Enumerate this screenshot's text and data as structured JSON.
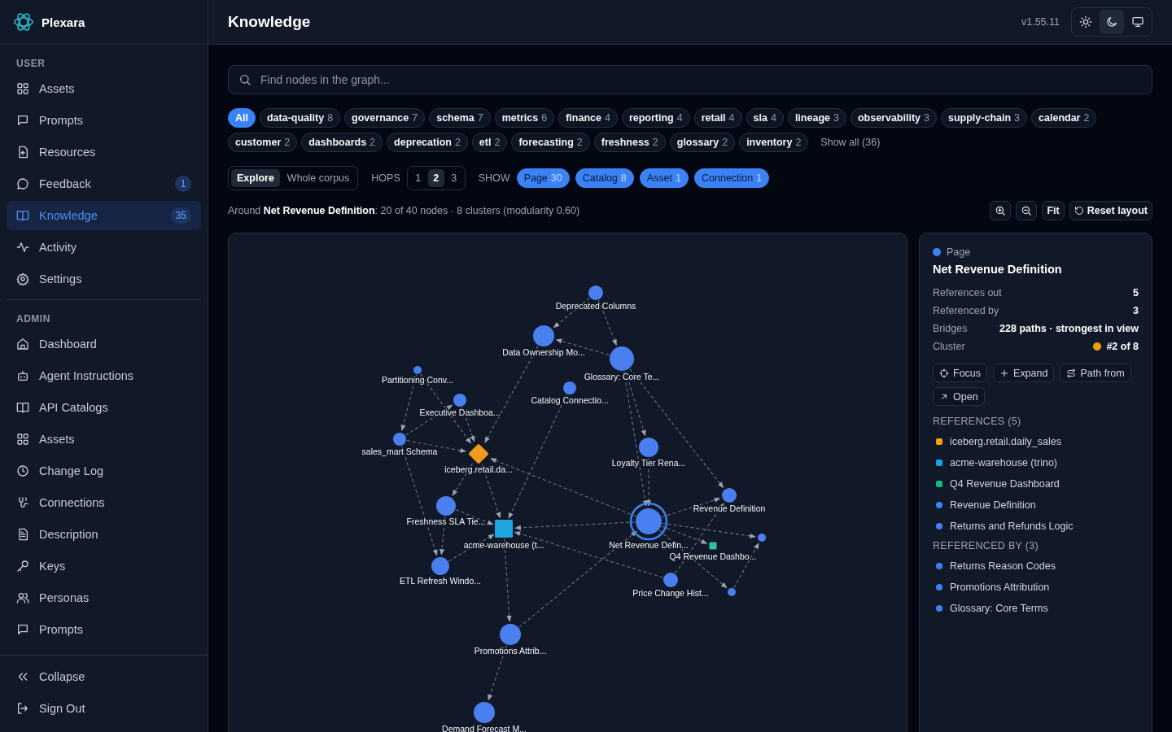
{
  "brand": {
    "name": "Plexara"
  },
  "sidebar": {
    "sections": [
      {
        "title": "USER",
        "items": [
          {
            "label": "Assets",
            "selected": false
          },
          {
            "label": "Prompts",
            "selected": false
          },
          {
            "label": "Resources",
            "selected": false
          },
          {
            "label": "Feedback",
            "badge": "1",
            "selected": false
          },
          {
            "label": "Knowledge",
            "badge": "35",
            "selected": true
          },
          {
            "label": "Activity",
            "selected": false
          },
          {
            "label": "Settings",
            "selected": false
          }
        ]
      },
      {
        "title": "ADMIN",
        "items": [
          {
            "label": "Dashboard",
            "selected": false
          },
          {
            "label": "Agent Instructions",
            "selected": false
          },
          {
            "label": "API Catalogs",
            "selected": false
          },
          {
            "label": "Assets",
            "selected": false
          },
          {
            "label": "Change Log",
            "selected": false
          },
          {
            "label": "Connections",
            "selected": false
          },
          {
            "label": "Description",
            "selected": false
          },
          {
            "label": "Keys",
            "selected": false
          },
          {
            "label": "Personas",
            "selected": false
          },
          {
            "label": "Prompts",
            "selected": false
          }
        ]
      }
    ],
    "footer": [
      {
        "label": "Collapse"
      },
      {
        "label": "Sign Out"
      }
    ]
  },
  "header": {
    "title": "Knowledge",
    "version": "v1.55.11",
    "theme_buttons": [
      {
        "selected": false
      },
      {
        "selected": true
      },
      {
        "selected": false
      }
    ]
  },
  "search": {
    "placeholder": "Find nodes in the graph..."
  },
  "tags": [
    {
      "label": "All",
      "selected": true
    },
    {
      "label": "data-quality",
      "count": "8",
      "selected": false
    },
    {
      "label": "governance",
      "count": "7",
      "selected": false
    },
    {
      "label": "schema",
      "count": "7",
      "selected": false
    },
    {
      "label": "metrics",
      "count": "6",
      "selected": false
    },
    {
      "label": "finance",
      "count": "4",
      "selected": false
    },
    {
      "label": "reporting",
      "count": "4",
      "selected": false
    },
    {
      "label": "retail",
      "count": "4",
      "selected": false
    },
    {
      "label": "sla",
      "count": "4",
      "selected": false
    },
    {
      "label": "lineage",
      "count": "3",
      "selected": false
    },
    {
      "label": "observability",
      "count": "3",
      "selected": false
    },
    {
      "label": "supply-chain",
      "count": "3",
      "selected": false
    },
    {
      "label": "calendar",
      "count": "2",
      "selected": false
    },
    {
      "label": "customer",
      "count": "2",
      "selected": false
    },
    {
      "label": "dashboards",
      "count": "2",
      "selected": false
    },
    {
      "label": "deprecation",
      "count": "2",
      "selected": false
    },
    {
      "label": "etl",
      "count": "2",
      "selected": false
    },
    {
      "label": "forecasting",
      "count": "2",
      "selected": false
    },
    {
      "label": "freshness",
      "count": "2",
      "selected": false
    },
    {
      "label": "glossary",
      "count": "2",
      "selected": false
    },
    {
      "label": "inventory",
      "count": "2",
      "selected": false
    }
  ],
  "show_all": "Show all (36)",
  "mode_tabs": [
    {
      "label": "Explore",
      "selected": true
    },
    {
      "label": "Whole corpus",
      "selected": false
    }
  ],
  "hops": {
    "label": "HOPS",
    "options": [
      {
        "label": "1",
        "selected": false
      },
      {
        "label": "2",
        "selected": true
      },
      {
        "label": "3",
        "selected": false
      }
    ]
  },
  "show": {
    "label": "SHOW",
    "filters": [
      {
        "label": "Page",
        "count": "30",
        "on": true
      },
      {
        "label": "Catalog",
        "count": "8",
        "on": true
      },
      {
        "label": "Asset",
        "count": "1",
        "on": true
      },
      {
        "label": "Connection",
        "count": "1",
        "on": true
      }
    ]
  },
  "summary": "Around **Net Revenue Definition**: 20 of 40 nodes · 8 clusters (modularity 0.60)",
  "graph_toolbar": {
    "fit": "Fit",
    "reset": "Reset layout"
  },
  "graph": {
    "nodes": [
      {
        "label": "Deprecated Columns",
        "kind": "page",
        "selected": false
      },
      {
        "label": "Data Ownership Mo...",
        "kind": "page",
        "selected": false
      },
      {
        "label": "Glossary: Core Te...",
        "kind": "page",
        "selected": false
      },
      {
        "label": "Partitioning Conv...",
        "kind": "page",
        "selected": false
      },
      {
        "label": "Catalog Connectio...",
        "kind": "page",
        "selected": false
      },
      {
        "label": "Executive Dashboa...",
        "kind": "page",
        "selected": false
      },
      {
        "label": "sales_mart Schema",
        "kind": "page",
        "selected": false
      },
      {
        "label": "iceberg.retail.da...",
        "kind": "asset",
        "selected": false
      },
      {
        "label": "Loyalty Tier Rena...",
        "kind": "page",
        "selected": false
      },
      {
        "label": "Revenue Definition",
        "kind": "page",
        "selected": false
      },
      {
        "label": "Freshness SLA Tie...",
        "kind": "page",
        "selected": false
      },
      {
        "label": "acme-warehouse (t...",
        "kind": "connection",
        "selected": false
      },
      {
        "label": "Net Revenue Defin...",
        "kind": "page",
        "selected": true
      },
      {
        "kind": "page",
        "selected": false
      },
      {
        "label": "Q4 Revenue Dashbo...",
        "kind": "catalog",
        "selected": false
      },
      {
        "label": "ETL Refresh Windo...",
        "kind": "page",
        "selected": false
      },
      {
        "label": "Price Change Hist...",
        "kind": "page",
        "selected": false
      },
      {
        "kind": "page",
        "selected": false
      },
      {
        "label": "Promotions Attrib...",
        "kind": "page",
        "selected": false
      },
      {
        "label": "Demand Forecast M...",
        "kind": "page",
        "selected": false
      }
    ],
    "selected_node_ring": true
  },
  "details": {
    "type": {
      "label": "Page",
      "color": "#3b82f6"
    },
    "title": "Net Revenue Definition",
    "stats": [
      {
        "label": "References out",
        "value": "5"
      },
      {
        "label": "Referenced by",
        "value": "3"
      },
      {
        "label": "Bridges",
        "value": "228 paths · strongest in view"
      },
      {
        "label": "Cluster",
        "value": "#2 of 8",
        "color": "#f59e0b"
      }
    ],
    "actions": [
      {
        "label": "Focus"
      },
      {
        "label": "Expand"
      },
      {
        "label": "Path from"
      },
      {
        "label": "Open"
      }
    ],
    "references": {
      "title": "REFERENCES (5)",
      "items": [
        {
          "label": "iceberg.retail.daily_sales",
          "kind": "asset",
          "color": "#f59e0b"
        },
        {
          "label": "acme-warehouse (trino)",
          "kind": "connection",
          "color": "#0ea5e9"
        },
        {
          "label": "Q4 Revenue Dashboard",
          "kind": "catalog",
          "color": "#10b981"
        },
        {
          "label": "Revenue Definition",
          "kind": "page",
          "color": "#3b82f6"
        },
        {
          "label": "Returns and Refunds Logic",
          "kind": "page",
          "color": "#3b82f6"
        }
      ]
    },
    "referenced_by": {
      "title": "REFERENCED BY (3)",
      "items": [
        {
          "label": "Returns Reason Codes",
          "kind": "page",
          "color": "#3b82f6"
        },
        {
          "label": "Promotions Attribution",
          "kind": "page",
          "color": "#3b82f6"
        },
        {
          "label": "Glossary: Core Terms",
          "kind": "page",
          "color": "#3b82f6"
        }
      ]
    }
  }
}
